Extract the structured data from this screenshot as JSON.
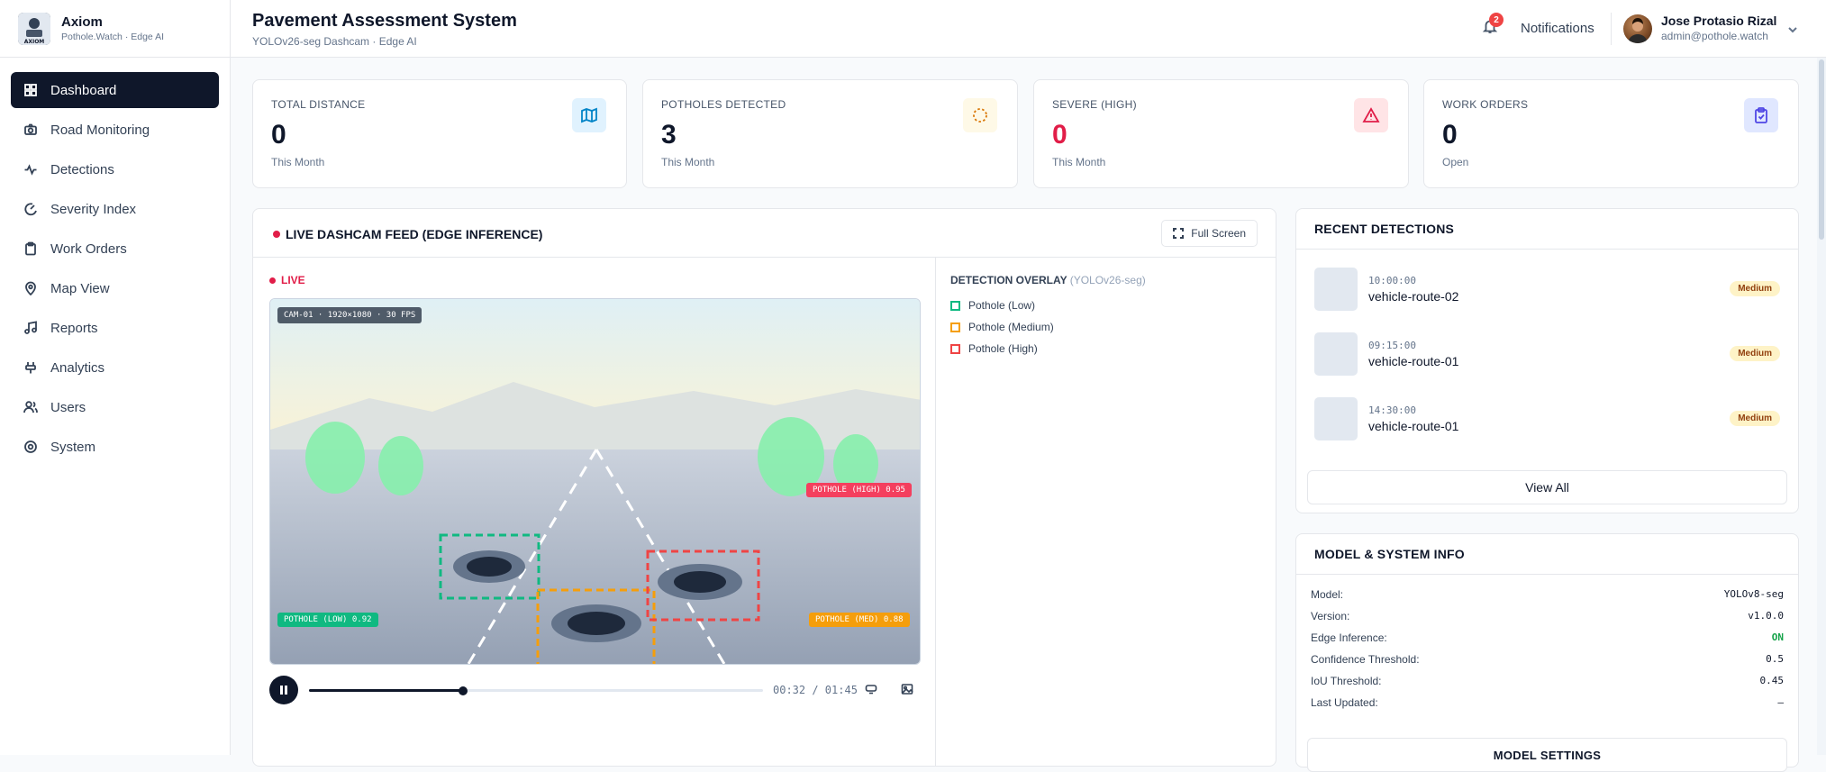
{
  "brand": {
    "name": "Axiom",
    "subtitle": "Pothole.Watch · Edge AI",
    "logo_text": "AXIOM"
  },
  "sidebar": {
    "items": [
      {
        "label": "Dashboard",
        "icon": "grid-icon",
        "active": true
      },
      {
        "label": "Road Monitoring",
        "icon": "camera-icon"
      },
      {
        "label": "Detections",
        "icon": "activity-icon"
      },
      {
        "label": "Severity Index",
        "icon": "gauge-icon"
      },
      {
        "label": "Work Orders",
        "icon": "clipboard-icon"
      },
      {
        "label": "Map View",
        "icon": "map-pin-icon"
      },
      {
        "label": "Reports",
        "icon": "music-note-icon"
      },
      {
        "label": "Analytics",
        "icon": "plug-icon"
      },
      {
        "label": "Users",
        "icon": "users-icon"
      },
      {
        "label": "System",
        "icon": "settings-icon"
      }
    ]
  },
  "header": {
    "title": "Pavement Assessment System",
    "subtitle": "YOLOv26-seg Dashcam · Edge AI",
    "notifications_label": "Notifications",
    "notifications_count": "2",
    "user_name": "Jose Protasio Rizal",
    "user_email": "admin@pothole.watch"
  },
  "stats": [
    {
      "label": "TOTAL DISTANCE",
      "value": "0",
      "note": "This Month",
      "icon": "map-icon",
      "value_color": "#0f172a",
      "icon_color": "#0284c7",
      "icon_bg": "#e0f2fe"
    },
    {
      "label": "POTHOLES DETECTED",
      "value": "3",
      "note": "This Month",
      "icon": "loader-dashed-circle-icon",
      "value_color": "#0f172a",
      "icon_color": "#d97706",
      "icon_bg": "#fef9e7"
    },
    {
      "label": "SEVERE (HIGH)",
      "value": "0",
      "note": "This Month",
      "icon": "alert-triangle-icon",
      "value_color": "#e11d48",
      "icon_color": "#e11d48",
      "icon_bg": "#ffe4e6"
    },
    {
      "label": "WORK ORDERS",
      "value": "0",
      "note": "Open",
      "icon": "clipboard-check-icon",
      "value_color": "#0f172a",
      "icon_color": "#4f46e5",
      "icon_bg": "#e0e7ff"
    }
  ],
  "feed": {
    "title": "LIVE DASHCAM FEED (EDGE INFERENCE)",
    "fullscreen_label": "Full Screen",
    "live_label": "LIVE",
    "cam_tag": "CAM-01 · 1920×1080 · 30 FPS",
    "detections": [
      {
        "label": "POTHOLE (HIGH) 0.95",
        "color": "#ef4444"
      },
      {
        "label": "POTHOLE (LOW) 0.92",
        "color": "#10b981"
      },
      {
        "label": "POTHOLE (MED) 0.88",
        "color": "#f59e0b"
      }
    ],
    "progress": 0.34,
    "time_current": "00:32",
    "time_total": "01:45",
    "time_display": "00:32 / 01:45"
  },
  "overlay": {
    "title": "DETECTION OVERLAY",
    "model": "(YOLOv26-seg)",
    "legend": [
      {
        "label": "Pothole (Low)",
        "color": "#10b981"
      },
      {
        "label": "Pothole (Medium)",
        "color": "#f59e0b"
      },
      {
        "label": "Pothole (High)",
        "color": "#ef4444"
      }
    ]
  },
  "recent": {
    "title": "RECENT DETECTIONS",
    "items": [
      {
        "time": "10:00:00",
        "name": "vehicle-route-02",
        "severity": "Medium"
      },
      {
        "time": "09:15:00",
        "name": "vehicle-route-01",
        "severity": "Medium"
      },
      {
        "time": "14:30:00",
        "name": "vehicle-route-01",
        "severity": "Medium"
      }
    ],
    "view_all_label": "View All"
  },
  "model_info": {
    "title": "MODEL & SYSTEM INFO",
    "rows": [
      {
        "key": "Model:",
        "value": "YOLOv8-seg"
      },
      {
        "key": "Version:",
        "value": "v1.0.0"
      },
      {
        "key": "Edge Inference:",
        "value": "ON"
      },
      {
        "key": "Confidence Threshold:",
        "value": "0.5"
      },
      {
        "key": "IoU Threshold:",
        "value": "0.45"
      },
      {
        "key": "Last Updated:",
        "value": "–"
      }
    ],
    "settings_label": "MODEL SETTINGS"
  }
}
